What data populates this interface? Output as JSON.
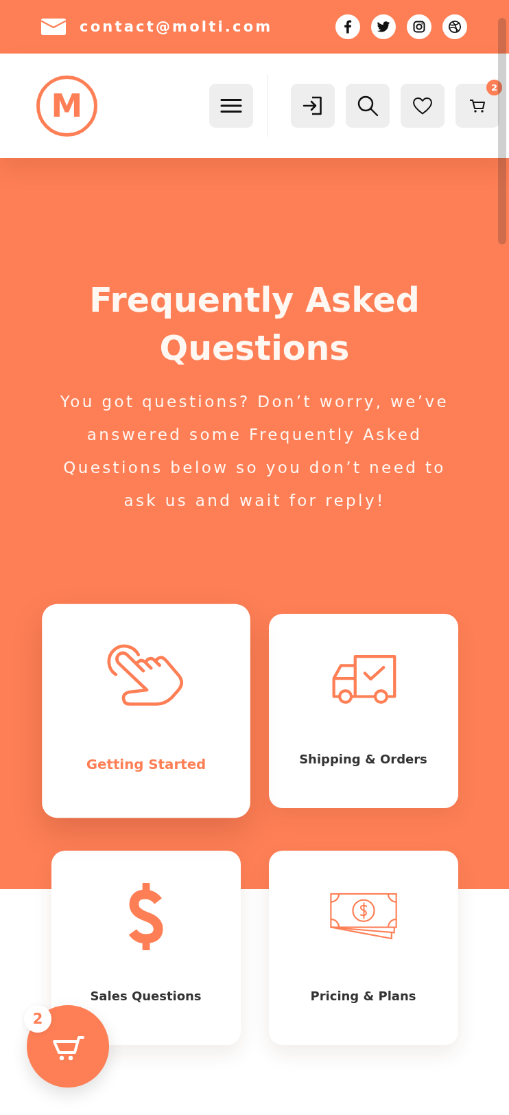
{
  "top_bar": {
    "email": "contact@molti.com"
  },
  "header": {
    "logo": "M",
    "cart_count": "2"
  },
  "hero": {
    "title": "Frequently Asked Questions",
    "subtitle": "You got questions? Don’t worry, we’ve answered some Frequently Asked Questions below so you don’t need to ask us and wait for reply!"
  },
  "categories": [
    {
      "label": "Getting Started",
      "selected": true
    },
    {
      "label": "Shipping & Orders",
      "selected": false
    },
    {
      "label": "Sales Questions",
      "selected": false
    },
    {
      "label": "Pricing & Plans",
      "selected": false
    }
  ],
  "floating_cart": {
    "count": "2"
  }
}
